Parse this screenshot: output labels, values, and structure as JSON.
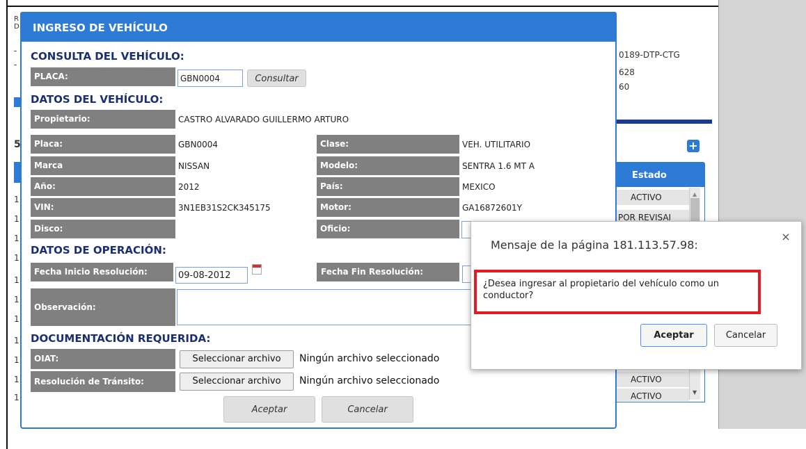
{
  "background": {
    "right_lines": [
      "0189-DTP-CTG",
      "628",
      "60"
    ],
    "table_header": "Estado",
    "rows": [
      "ACTIVO",
      "POR REVISAI",
      "ACTIVO",
      "ACTIVO"
    ],
    "left_glyphs": [
      "R",
      "D",
      "-",
      "-",
      "5",
      "1",
      "1",
      "1",
      "1",
      "1",
      "1",
      "1",
      "1",
      "1",
      "1",
      "1",
      "1",
      "1"
    ]
  },
  "modal": {
    "title": "INGRESO DE VEHÍCULO",
    "consulta": {
      "heading": "CONSULTA DEL VEHÍCULO:",
      "placa_label": "PLACA:",
      "placa_value": "GBN0004",
      "consultar_label": "Consultar"
    },
    "datos": {
      "heading": "DATOS DEL VEHÍCULO:",
      "propietario_label": "Propietario:",
      "propietario_value": "CASTRO ALVARADO GUILLERMO ARTURO",
      "placa_label": "Placa:",
      "placa_value": "GBN0004",
      "clase_label": "Clase:",
      "clase_value": "VEH. UTILITARIO",
      "marca_label": "Marca",
      "marca_value": "NISSAN",
      "modelo_label": "Modelo:",
      "modelo_value": "SENTRA 1.6 MT A",
      "anio_label": "Año:",
      "anio_value": "2012",
      "pais_label": "País:",
      "pais_value": "MEXICO",
      "vin_label": "VIN:",
      "vin_value": "3N1EB31S2CK345175",
      "motor_label": "Motor:",
      "motor_value": "GA16872601Y",
      "disco_label": "Disco:",
      "oficio_label": "Oficio:"
    },
    "operacion": {
      "heading": "DATOS DE OPERACIÓN:",
      "fecha_inicio_label": "Fecha Inicio Resolución:",
      "fecha_inicio_value": "09-08-2012",
      "fecha_fin_label": "Fecha Fin Resolución:",
      "observacion_label": "Observación:"
    },
    "documentacion": {
      "heading": "DOCUMENTACIÓN REQUERIDA:",
      "oiat_label": "OIAT:",
      "resolucion_label": "Resolución de Tránsito:",
      "select_file_label": "Seleccionar archivo",
      "no_file_text": "Ningún archivo seleccionado"
    },
    "aceptar_label": "Aceptar",
    "cancelar_label": "Cancelar"
  },
  "dialog": {
    "title": "Mensaje de la página 181.113.57.98:",
    "close_glyph": "×",
    "message": "¿Desea ingresar al propietario del vehículo como un conductor?",
    "aceptar_label": "Aceptar",
    "cancelar_label": "Cancelar",
    "highlight_color": "#e51b24"
  }
}
